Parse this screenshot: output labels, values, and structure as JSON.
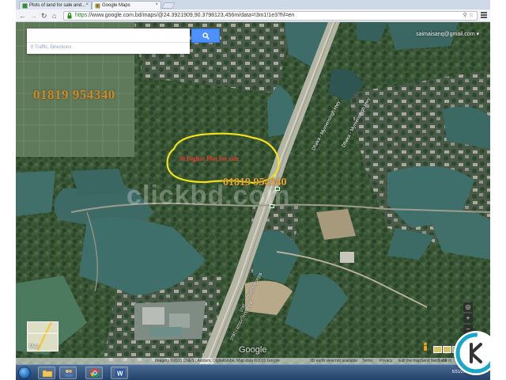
{
  "browser": {
    "tabs": [
      {
        "label": "Plots of land for sale and...",
        "favicon": "page-icon",
        "active": false
      },
      {
        "label": "Google Maps",
        "favicon": "maps-icon",
        "active": true
      }
    ],
    "url_scheme": "https",
    "url_rest": "://www.google.com.bd/maps/@24.3921909,90.3798123,456m/data=!3m1!1e3?hl=en"
  },
  "map": {
    "search_placeholder": "",
    "directions_link": "Traffic, Directions",
    "account_email": "saimaisanq@gmail.com",
    "overlay_phone_1": "01819 954340",
    "overlay_phone_2": "01819 954340",
    "plot_label": "30 Bighas Plot for sale",
    "watermark": "clickbd.com",
    "road_labels": [
      "Dhaka - Mymensingh Hwy",
      "Dhaka - Mymensingh Hwy",
      "ঢাকা - ময়মনসিংহ সড়ক",
      "ঢাকা - ময়মনসিংহ সড়ক"
    ],
    "shield_label": "N3",
    "google_logo": "Google",
    "minimap_label": "Map",
    "attribution": [
      "Imagery ©2015 CNES / Astrium, DigitalGlobe, Map data ©2015 Google",
      "3D earth view not available",
      "Terms",
      "Privacy",
      "Edit the map",
      "Send feedback",
      "60 m"
    ]
  },
  "taskbar": {
    "items": [
      "folder-icon",
      "people-icon",
      "chrome-icon",
      "word-icon"
    ],
    "date": "5/31/2015"
  },
  "colors": {
    "search_button": "#4d90fe",
    "plot_outline": "#f2e11a",
    "phone_text": "#c88a2e",
    "plot_label_text": "#e04030"
  }
}
